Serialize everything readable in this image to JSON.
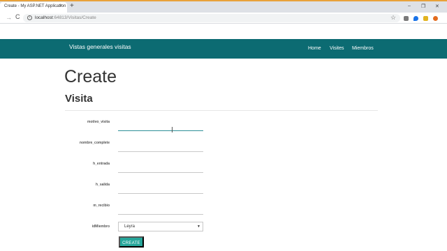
{
  "browser": {
    "tab_title": "Create - My ASP.NET Application",
    "tab_close": "×",
    "new_tab": "+",
    "win_minimize": "–",
    "win_maximize": "❐",
    "win_close": "✕",
    "url_host": "localhost",
    "url_rest": ":64813/Visitas/Create",
    "back_glyph": "→",
    "reload_glyph": "C"
  },
  "navbar": {
    "brand": "Vistas generales visitas",
    "links": [
      "Home",
      "Visites",
      "Miembros"
    ]
  },
  "page": {
    "heading": "Create",
    "subheading": "Visita"
  },
  "form": {
    "fields": [
      {
        "label": "motivo_visita",
        "value": ""
      },
      {
        "label": "nombre_complete",
        "value": ""
      },
      {
        "label": "h_entrada",
        "value": ""
      },
      {
        "label": "h_salida",
        "value": ""
      },
      {
        "label": "m_recibio",
        "value": ""
      }
    ],
    "select_label": "idMiembro",
    "select_value": "Leyra",
    "select_caret": "▼",
    "submit_label": "CREATE"
  },
  "colors": {
    "navbar": "#0c6b72",
    "button": "#26a69a",
    "top_accent": "#e8a13a"
  }
}
